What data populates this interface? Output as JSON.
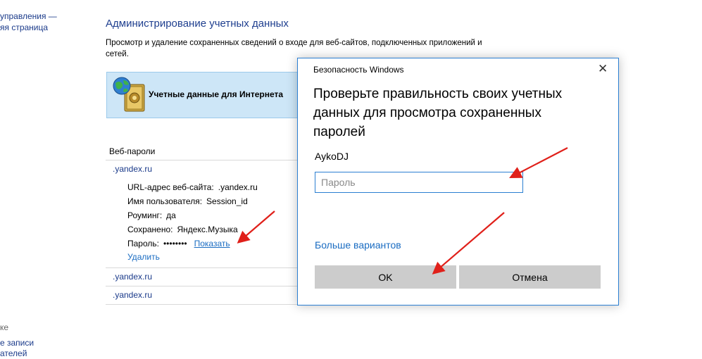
{
  "sidebar": {
    "top_link_1": "управления —",
    "top_link_2": "яя страница",
    "see_also": "ке",
    "bottom_link_1": "е записи",
    "bottom_link_2": "ателей"
  },
  "main": {
    "title": "Администрирование учетных данных",
    "description": "Просмотр и удаление сохраненных сведений о входе для веб-сайтов, подключенных приложений и сетей.",
    "credential_type_label": "Учетные данные для Интернета",
    "list_header": "Веб-пароли",
    "entries": [
      {
        "site": ".yandex.ru"
      },
      {
        "site": ".yandex.ru"
      },
      {
        "site": ".yandex.ru"
      }
    ],
    "details": {
      "url_label": "URL-адрес веб-сайта:",
      "url_value": ".yandex.ru",
      "user_label": "Имя пользователя:",
      "user_value": "Session_id",
      "roaming_label": "Роуминг:",
      "roaming_value": "да",
      "saved_label": "Сохранено:",
      "saved_value": "Яндекс.Музыка",
      "password_label": "Пароль:",
      "password_value": "••••••••",
      "show_link": "Показать",
      "remove_link": "Удалить"
    }
  },
  "dialog": {
    "window_title": "Безопасность Windows",
    "heading": "Проверьте правильность своих учетных данных для просмотра сохраненных паролей",
    "username": "AykoDJ",
    "password_placeholder": "Пароль",
    "more_options": "Больше вариантов",
    "ok_label": "OK",
    "cancel_label": "Отмена"
  },
  "colors": {
    "accent": "#2b7fd2",
    "link": "#1a6cc2",
    "title": "#1f3f8f",
    "band": "#cde6f7",
    "arrow": "#e0201a",
    "button": "#cccccc"
  },
  "icons": [
    "globe-safe-icon",
    "close-icon"
  ]
}
